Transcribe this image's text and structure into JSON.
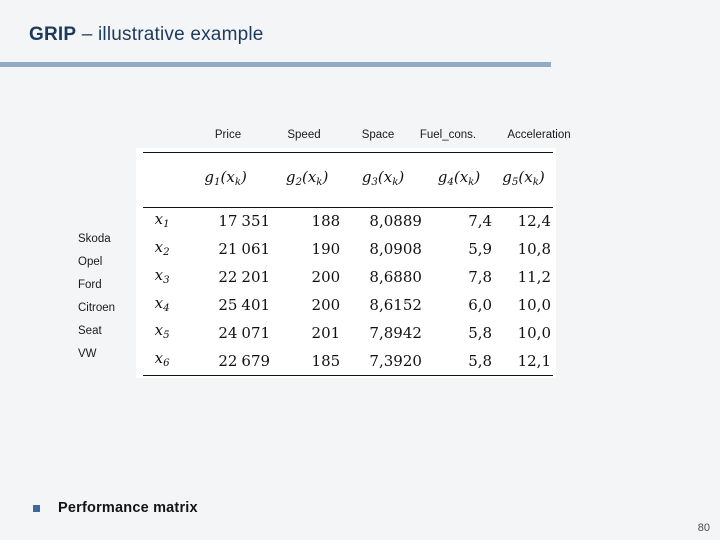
{
  "slide": {
    "title_strong": "GRIP",
    "title_rest": " – illustrative example",
    "page_number": "80",
    "accent_rule_color": "#93abc6",
    "title_color": "#1b3a5e",
    "bullet_color": "#3c6a9d"
  },
  "bullet": {
    "label": "Performance matrix"
  },
  "chart_data": {
    "type": "table",
    "title": "Performance matrix",
    "columns": [
      "Price",
      "Speed",
      "Space",
      "Fuel_cons.",
      "Acceleration"
    ],
    "criterion_functions": [
      "g1(xk)",
      "g2(xk)",
      "g3(xk)",
      "g4(xk)",
      "g5(xk)"
    ],
    "alternatives": [
      "Skoda",
      "Opel",
      "Ford",
      "Citroen",
      "Seat",
      "VW"
    ],
    "variables": [
      "x1",
      "x2",
      "x3",
      "x4",
      "x5",
      "x6"
    ],
    "rows": [
      {
        "name": "Skoda",
        "var": "x1",
        "price": "17 351",
        "speed": "188",
        "space": "8,0889",
        "fuel_cons": "7,4",
        "acceleration": "12,4"
      },
      {
        "name": "Opel",
        "var": "x2",
        "price": "21 061",
        "speed": "190",
        "space": "8,0908",
        "fuel_cons": "5,9",
        "acceleration": "10,8"
      },
      {
        "name": "Ford",
        "var": "x3",
        "price": "22 201",
        "speed": "200",
        "space": "8,6880",
        "fuel_cons": "7,8",
        "acceleration": "11,2"
      },
      {
        "name": "Citroen",
        "var": "x4",
        "price": "25 401",
        "speed": "200",
        "space": "8,6152",
        "fuel_cons": "6,0",
        "acceleration": "10,0"
      },
      {
        "name": "Seat",
        "var": "x5",
        "price": "24 071",
        "speed": "201",
        "space": "7,8942",
        "fuel_cons": "5,8",
        "acceleration": "10,0"
      },
      {
        "name": "VW",
        "var": "x6",
        "price": "22 679",
        "speed": "185",
        "space": "7,3920",
        "fuel_cons": "5,8",
        "acceleration": "12,1"
      }
    ]
  },
  "table": {
    "headers": [
      {
        "label": "Price"
      },
      {
        "label": "Speed"
      },
      {
        "label": "Space"
      },
      {
        "label": "Fuel_cons."
      },
      {
        "label": "Acceleration"
      }
    ],
    "func_base": "g",
    "func_indices": [
      "1",
      "2",
      "3",
      "4",
      "5"
    ],
    "func_arg": "(x",
    "func_arg_sub": "k",
    "func_arg_close": ")",
    "var_base": "x",
    "row_labels": [
      "Skoda",
      "Opel",
      "Ford",
      "Citroen",
      "Seat",
      "VW"
    ],
    "cells": [
      [
        "17",
        "351",
        "188",
        "8,0889",
        "7,4",
        "12,4"
      ],
      [
        "21",
        "061",
        "190",
        "8,0908",
        "5,9",
        "10,8"
      ],
      [
        "22",
        "201",
        "200",
        "8,6880",
        "7,8",
        "11,2"
      ],
      [
        "25",
        "401",
        "200",
        "8,6152",
        "6,0",
        "10,0"
      ],
      [
        "24",
        "071",
        "201",
        "7,8942",
        "5,8",
        "10,0"
      ],
      [
        "22",
        "679",
        "185",
        "7,3920",
        "5,8",
        "12,1"
      ]
    ],
    "var_indices": [
      "1",
      "2",
      "3",
      "4",
      "5",
      "6"
    ]
  }
}
